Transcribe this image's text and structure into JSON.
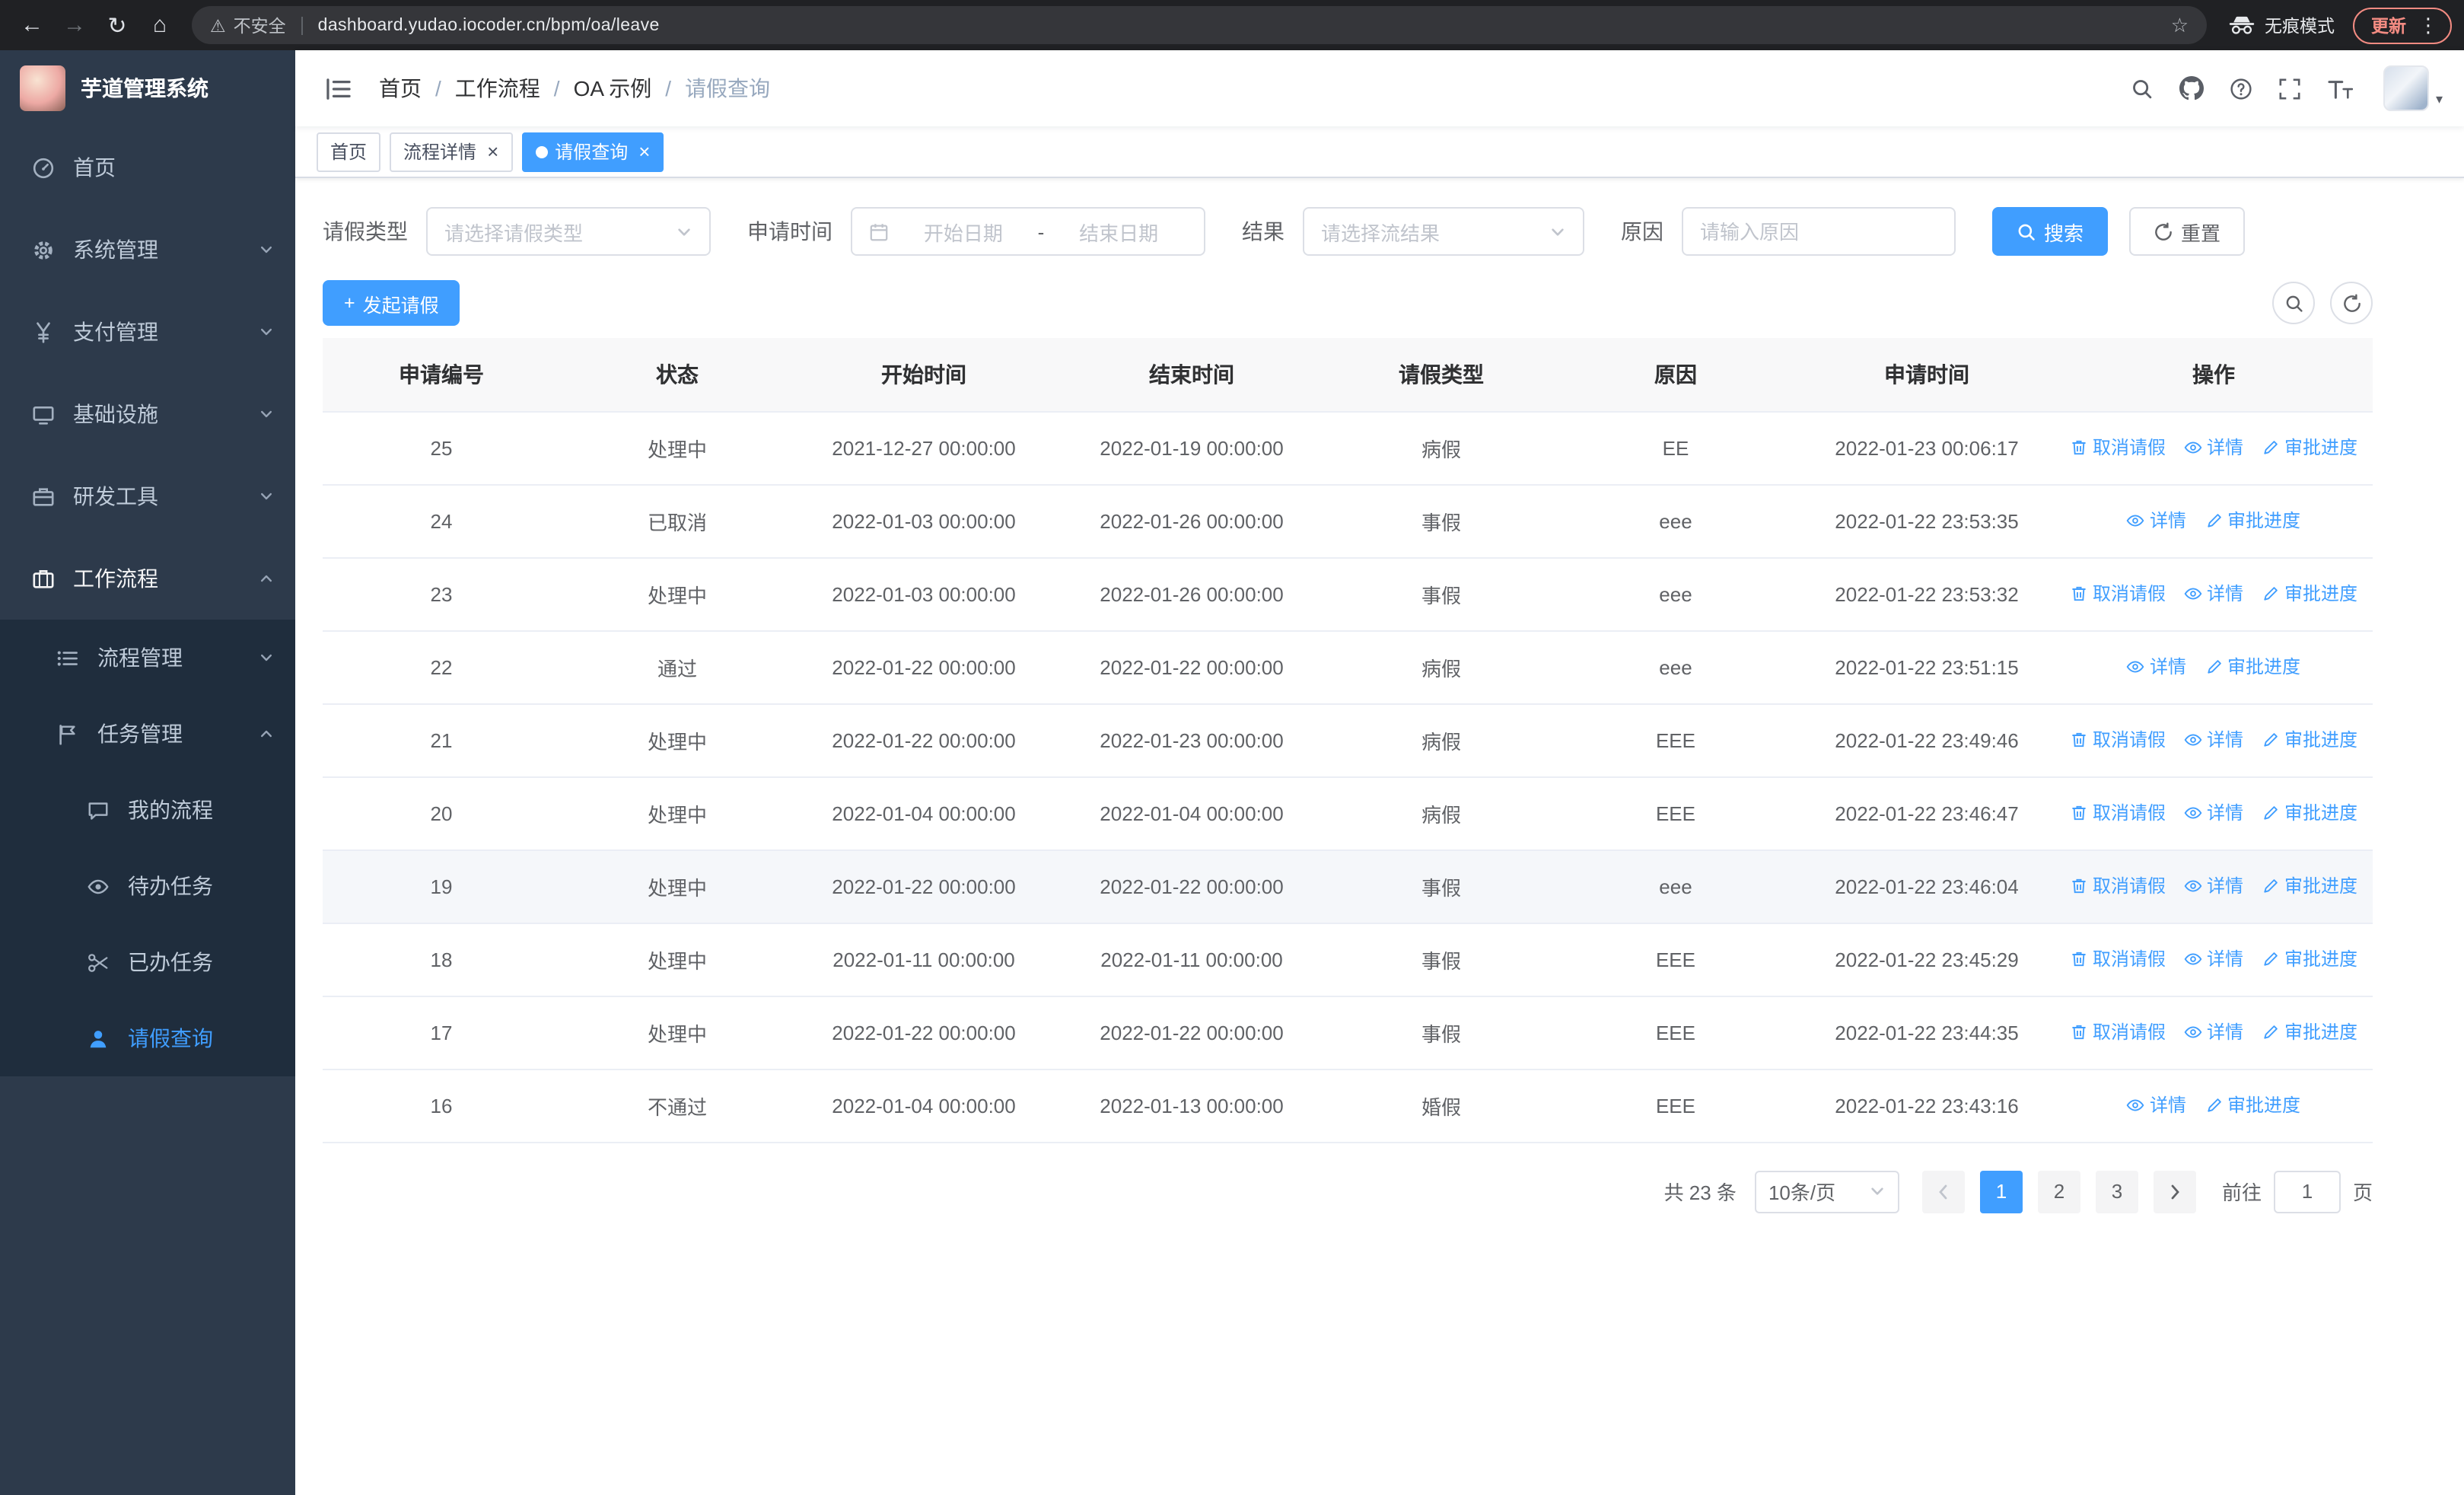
{
  "browser": {
    "security_warning": "不安全",
    "url": "dashboard.yudao.iocoder.cn/bpm/oa/leave",
    "incognito_label": "无痕模式",
    "update_label": "更新"
  },
  "icons": {
    "back": "←",
    "forward": "→",
    "reload": "↻",
    "home": "⌂",
    "warning": "⚠",
    "star": "☆",
    "menu_dots": "⋮",
    "close": "×",
    "plus": "+",
    "caret_down": "▾"
  },
  "sidebar": {
    "logo_title": "芋道管理系统",
    "menu": [
      {
        "label": "首页"
      },
      {
        "label": "系统管理"
      },
      {
        "label": "支付管理"
      },
      {
        "label": "基础设施"
      },
      {
        "label": "研发工具"
      },
      {
        "label": "工作流程"
      }
    ],
    "workflow_children": [
      {
        "label": "流程管理"
      },
      {
        "label": "任务管理"
      }
    ],
    "task_children": [
      {
        "label": "我的流程"
      },
      {
        "label": "待办任务"
      },
      {
        "label": "已办任务"
      },
      {
        "label": "请假查询"
      }
    ]
  },
  "header": {
    "breadcrumb": [
      "首页",
      "工作流程",
      "OA 示例",
      "请假查询"
    ],
    "separator": "/"
  },
  "tabs": [
    {
      "label": "首页",
      "closable": false,
      "active": false
    },
    {
      "label": "流程详情",
      "closable": true,
      "active": false
    },
    {
      "label": "请假查询",
      "closable": true,
      "active": true
    }
  ],
  "filters": {
    "leave_type_label": "请假类型",
    "leave_type_placeholder": "请选择请假类型",
    "apply_time_label": "申请时间",
    "start_date_placeholder": "开始日期",
    "range_separator": "-",
    "end_date_placeholder": "结束日期",
    "result_label": "结果",
    "result_placeholder": "请选择流结果",
    "reason_label": "原因",
    "reason_placeholder": "请输入原因",
    "search_button": "搜索",
    "reset_button": "重置"
  },
  "toolbar": {
    "create_button": "发起请假"
  },
  "table": {
    "columns": [
      "申请编号",
      "状态",
      "开始时间",
      "结束时间",
      "请假类型",
      "原因",
      "申请时间",
      "操作"
    ],
    "actions": {
      "cancel": "取消请假",
      "detail": "详情",
      "progress": "审批进度"
    },
    "rows": [
      {
        "id": "25",
        "status": "处理中",
        "start": "2021-12-27 00:00:00",
        "end": "2022-01-19 00:00:00",
        "type": "病假",
        "reason": "EE",
        "apply_time": "2022-01-23 00:06:17",
        "cancellable": true,
        "hover": false
      },
      {
        "id": "24",
        "status": "已取消",
        "start": "2022-01-03 00:00:00",
        "end": "2022-01-26 00:00:00",
        "type": "事假",
        "reason": "eee",
        "apply_time": "2022-01-22 23:53:35",
        "cancellable": false,
        "hover": false
      },
      {
        "id": "23",
        "status": "处理中",
        "start": "2022-01-03 00:00:00",
        "end": "2022-01-26 00:00:00",
        "type": "事假",
        "reason": "eee",
        "apply_time": "2022-01-22 23:53:32",
        "cancellable": true,
        "hover": false
      },
      {
        "id": "22",
        "status": "通过",
        "start": "2022-01-22 00:00:00",
        "end": "2022-01-22 00:00:00",
        "type": "病假",
        "reason": "eee",
        "apply_time": "2022-01-22 23:51:15",
        "cancellable": false,
        "hover": false
      },
      {
        "id": "21",
        "status": "处理中",
        "start": "2022-01-22 00:00:00",
        "end": "2022-01-23 00:00:00",
        "type": "病假",
        "reason": "EEE",
        "apply_time": "2022-01-22 23:49:46",
        "cancellable": true,
        "hover": false
      },
      {
        "id": "20",
        "status": "处理中",
        "start": "2022-01-04 00:00:00",
        "end": "2022-01-04 00:00:00",
        "type": "病假",
        "reason": "EEE",
        "apply_time": "2022-01-22 23:46:47",
        "cancellable": true,
        "hover": false
      },
      {
        "id": "19",
        "status": "处理中",
        "start": "2022-01-22 00:00:00",
        "end": "2022-01-22 00:00:00",
        "type": "事假",
        "reason": "eee",
        "apply_time": "2022-01-22 23:46:04",
        "cancellable": true,
        "hover": true
      },
      {
        "id": "18",
        "status": "处理中",
        "start": "2022-01-11 00:00:00",
        "end": "2022-01-11 00:00:00",
        "type": "事假",
        "reason": "EEE",
        "apply_time": "2022-01-22 23:45:29",
        "cancellable": true,
        "hover": false
      },
      {
        "id": "17",
        "status": "处理中",
        "start": "2022-01-22 00:00:00",
        "end": "2022-01-22 00:00:00",
        "type": "事假",
        "reason": "EEE",
        "apply_time": "2022-01-22 23:44:35",
        "cancellable": true,
        "hover": false
      },
      {
        "id": "16",
        "status": "不通过",
        "start": "2022-01-04 00:00:00",
        "end": "2022-01-13 00:00:00",
        "type": "婚假",
        "reason": "EEE",
        "apply_time": "2022-01-22 23:43:16",
        "cancellable": false,
        "hover": false
      }
    ]
  },
  "pagination": {
    "total_text": "共 23 条",
    "page_size": "10条/页",
    "pages": [
      "1",
      "2",
      "3"
    ],
    "active_page": "1",
    "goto_label": "前往",
    "goto_value": "1",
    "page_unit": "页"
  },
  "colors": {
    "primary": "#409eff",
    "sidebar_bg": "#2d3a4b",
    "submenu_bg": "#1f2d3d",
    "chrome_bg": "#202124",
    "update_accent": "#f28b82",
    "table_header_bg": "#f8f8f9"
  }
}
